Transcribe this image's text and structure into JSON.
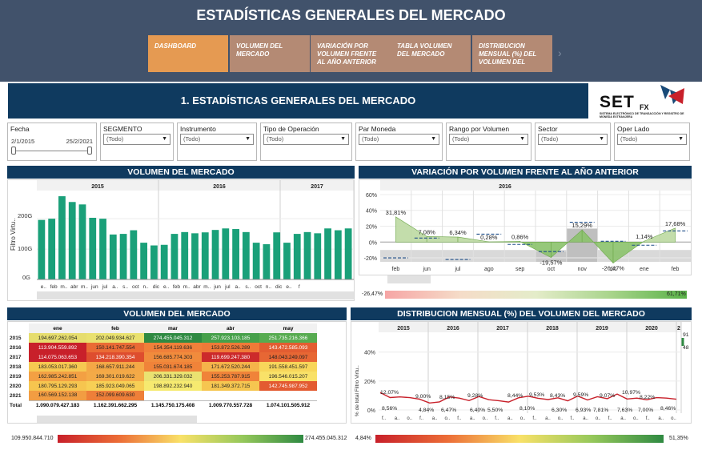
{
  "app_title": "ESTADÍSTICAS GENERALES DEL MERCADO",
  "nav": [
    {
      "label": "DASHBOARD",
      "active": true
    },
    {
      "label": "VOLUMEN DEL MERCADO",
      "active": false
    },
    {
      "label": "VARIACIÓN POR VOLUMEN FRENTE AL AÑO ANTERIOR",
      "active": false
    },
    {
      "label": "TABLA VOLUMEN DEL MERCADO",
      "active": false
    },
    {
      "label": "DISTRIBUCION MENSUAL (%) DEL VOLUMEN DEL",
      "active": false
    }
  ],
  "section_title": "1. ESTADÍSTICAS GENERALES DEL MERCADO",
  "logo": {
    "text": "SET",
    "sub": "FX",
    "caption": "SISTEMA ELECTRÓNICO DE TRANSACCIÓN Y REGISTRO DE MONEDA EXTRANJERA"
  },
  "filters": {
    "fecha": {
      "label": "Fecha",
      "start": "2/1/2015",
      "end": "25/2/2021"
    },
    "items": [
      {
        "label": "SEGMENTO",
        "value": "(Todo)"
      },
      {
        "label": "Instrumento",
        "value": "(Todo)"
      },
      {
        "label": "Tipo de Operación",
        "value": "(Todo)"
      },
      {
        "label": "Par Moneda",
        "value": "(Todo)"
      },
      {
        "label": "Rango por Volumen",
        "value": "(Todo)"
      },
      {
        "label": "Sector",
        "value": "(Todo)"
      },
      {
        "label": "Oper Lado",
        "value": "(Todo)"
      }
    ]
  },
  "titles": {
    "volumen": "VOLUMEN DEL MERCADO",
    "variacion": "VARIACIÓN POR VOLUMEN FRENTE AL AÑO ANTERIOR",
    "tabla": "VOLUMEN DEL MERCADO",
    "distribucion": "DISTRIBUCION MENSUAL (%) DEL VOLUMEN DEL MERCADO"
  },
  "chart_data": [
    {
      "type": "bar",
      "title": "VOLUMEN DEL MERCADO",
      "ylabel": "Filtro Virtu..",
      "yticks": [
        "200G",
        "100G",
        "0G"
      ],
      "ylim": [
        0,
        290
      ],
      "years": [
        "2015",
        "2016",
        "2017"
      ],
      "month_ticks": [
        "e..",
        "feb",
        "m..",
        "abr",
        "m..",
        "jun",
        "jul",
        "a..",
        "s..",
        "oct",
        "n..",
        "dic",
        "e..",
        "feb",
        "m..",
        "abr",
        "m..",
        "jun",
        "jul",
        "a..",
        "s..",
        "oct",
        "n..",
        "dic",
        "e..",
        "f"
      ],
      "values": [
        196,
        200,
        274,
        255,
        247,
        203,
        200,
        148,
        150,
        162,
        121,
        112,
        114,
        150,
        156,
        152,
        155,
        163,
        168,
        166,
        156,
        121,
        116,
        155,
        121,
        150,
        156,
        152,
        168,
        162,
        168
      ],
      "color": "#1aa079"
    },
    {
      "type": "area",
      "title": "VARIACIÓN POR VOLUMEN FRENTE AL AÑO ANTERIOR",
      "year": "2016",
      "yticks": [
        "60%",
        "40%",
        "20%",
        "0%",
        "-20%"
      ],
      "ylim": [
        -25,
        62
      ],
      "categories": [
        "feb",
        "jun",
        "jul",
        "ago",
        "sep",
        "oct",
        "nov",
        "dic",
        "ene",
        "feb"
      ],
      "values": [
        31.81,
        7.08,
        6.34,
        0.28,
        0.86,
        -19.57,
        15.29,
        -26.47,
        1.14,
        17.68
      ],
      "labels": [
        "31,81%",
        "7,08%",
        "6,34%",
        "0,28%",
        "0,86%",
        "-19,57%",
        "15,29%",
        "-26,47%",
        "1,14%",
        "17,68%"
      ],
      "legend_min": "-26,47%",
      "legend_max": "61,71%"
    },
    {
      "type": "table",
      "title": "VOLUMEN DEL MERCADO",
      "columns": [
        "ene",
        "feb",
        "mar",
        "abr",
        "may"
      ],
      "rows": [
        {
          "year": "2015",
          "values": [
            "194.697.262.054",
            "202.049.934.627",
            "274.455.045.312",
            "257.923.103.185",
            "251.735.216.366"
          ],
          "bg": [
            "#e6dd6e",
            "#e9e16f",
            "#2f8a42",
            "#46a04a",
            "#57ab50"
          ],
          "fg": [
            "#222",
            "#222",
            "#fff",
            "#fff",
            "#fff"
          ]
        },
        {
          "year": "2016",
          "values": [
            "113.904.559.892",
            "150.141.747.554",
            "154.354.119.636",
            "153.872.526.289",
            "143.472.585.093"
          ],
          "bg": [
            "#c8202a",
            "#ea6b35",
            "#f0803a",
            "#ef7a38",
            "#e35d31"
          ],
          "fg": [
            "#fff",
            "#222",
            "#222",
            "#222",
            "#fff"
          ]
        },
        {
          "year": "2017",
          "values": [
            "114.075.063.653",
            "134.218.390.354",
            "156.685.774.303",
            "119.699.247.380",
            "148.043.249.097"
          ],
          "bg": [
            "#c8202a",
            "#de4d2e",
            "#f18b3c",
            "#cc2a2b",
            "#e76734"
          ],
          "fg": [
            "#fff",
            "#fff",
            "#222",
            "#fff",
            "#222"
          ]
        },
        {
          "year": "2018",
          "values": [
            "183.053.017.360",
            "168.657.911.244",
            "155.031.674.185",
            "171.672.520.244",
            "191.558.451.597"
          ],
          "bg": [
            "#f6c851",
            "#f4a846",
            "#f08339",
            "#f5b34a",
            "#f8d65a"
          ],
          "fg": [
            "#222",
            "#222",
            "#222",
            "#222",
            "#222"
          ]
        },
        {
          "year": "2019",
          "values": [
            "162.985.242.851",
            "169.301.019.622",
            "206.331.329.032",
            "155.253.787.915",
            "196.546.015.207"
          ],
          "bg": [
            "#f3a043",
            "#f4aa47",
            "#eae271",
            "#f08339",
            "#f9e168"
          ],
          "fg": [
            "#222",
            "#222",
            "#222",
            "#222",
            "#222"
          ]
        },
        {
          "year": "2020",
          "values": [
            "180.795.129.293",
            "185.923.049.065",
            "198.892.232.940",
            "181.349.372.715",
            "142.745.987.952"
          ],
          "bg": [
            "#f6c54f",
            "#f7cf55",
            "#f6ea70",
            "#f6c650",
            "#e35b31"
          ],
          "fg": [
            "#222",
            "#222",
            "#222",
            "#222",
            "#fff"
          ]
        },
        {
          "year": "2021",
          "values": [
            "160.569.152.138",
            "152.099.609.630",
            "",
            "",
            ""
          ],
          "bg": [
            "#f29d42",
            "#ee7f39",
            "",
            "",
            ""
          ],
          "fg": [
            "#222",
            "#222",
            "",
            "",
            ""
          ]
        }
      ],
      "total_label": "Total",
      "totals": [
        "1.090.079.427.183",
        "1.162.391.662.295",
        "1.145.750.175.408",
        "1.009.770.557.728",
        "1.074.101.505.912"
      ],
      "legend_min": "109.950.844.710",
      "legend_max": "274.455.045.312"
    },
    {
      "type": "line",
      "title": "DISTRIBUCION MENSUAL (%) DEL VOLUMEN DEL MERCADO",
      "ylabel": "% de total Filtro Virtu..",
      "yticks": [
        "40%",
        "20%",
        "0%"
      ],
      "years": [
        "2015",
        "2016",
        "2017",
        "2018",
        "2019",
        "2020",
        "2"
      ],
      "annotations": [
        "12,07%",
        "8,56%",
        "9,00%",
        "4,84%",
        "8,15%",
        "6,47%",
        "9,28%",
        "6,40%",
        "5,50%",
        "8,44%",
        "9,53%",
        "8,10%",
        "8,43%",
        "6,30%",
        "9,59%",
        "6,93%",
        "9,07%",
        "7,81%",
        "10,97%",
        "7,63%",
        "8,22%",
        "7,00%",
        "8,46%",
        "91",
        "48"
      ],
      "legend_min": "4,84%",
      "legend_max": "51,35%"
    }
  ]
}
